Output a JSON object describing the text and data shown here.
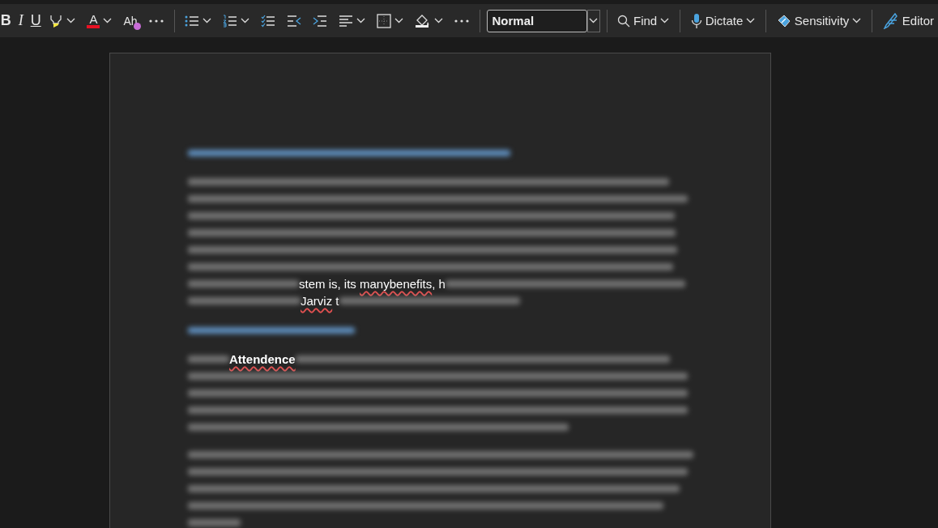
{
  "toolbar": {
    "format_buttons": [
      {
        "kind": "bold",
        "label": "B"
      },
      {
        "kind": "italic",
        "label": "I"
      },
      {
        "kind": "underline",
        "label": "U"
      }
    ],
    "font_color_glyph": "A",
    "clear_formatting_glyph": "Ah",
    "style_box": {
      "value": "Normal"
    },
    "commands": [
      {
        "kind": "find",
        "label": "Find",
        "dropdown": true
      },
      {
        "kind": "dictate",
        "label": "Dictate",
        "dropdown": true
      },
      {
        "kind": "sensitivity",
        "label": "Sensitivity",
        "dropdown": true
      },
      {
        "kind": "editor",
        "label": "Editor",
        "dropdown": false
      }
    ]
  },
  "document": {
    "visible_fragments": [
      {
        "bold": false,
        "runs": [
          {
            "text": "stem is, its ",
            "misspelled": false
          },
          {
            "text": "manybenefits",
            "misspelled": true
          },
          {
            "text": ", h",
            "misspelled": false
          }
        ]
      },
      {
        "bold": false,
        "runs": [
          {
            "text": "Jarviz",
            "misspelled": true
          },
          {
            "text": " t",
            "misspelled": false
          }
        ]
      },
      {
        "bold": true,
        "runs": [
          {
            "text": "Attendence",
            "misspelled": true
          }
        ]
      }
    ]
  }
}
